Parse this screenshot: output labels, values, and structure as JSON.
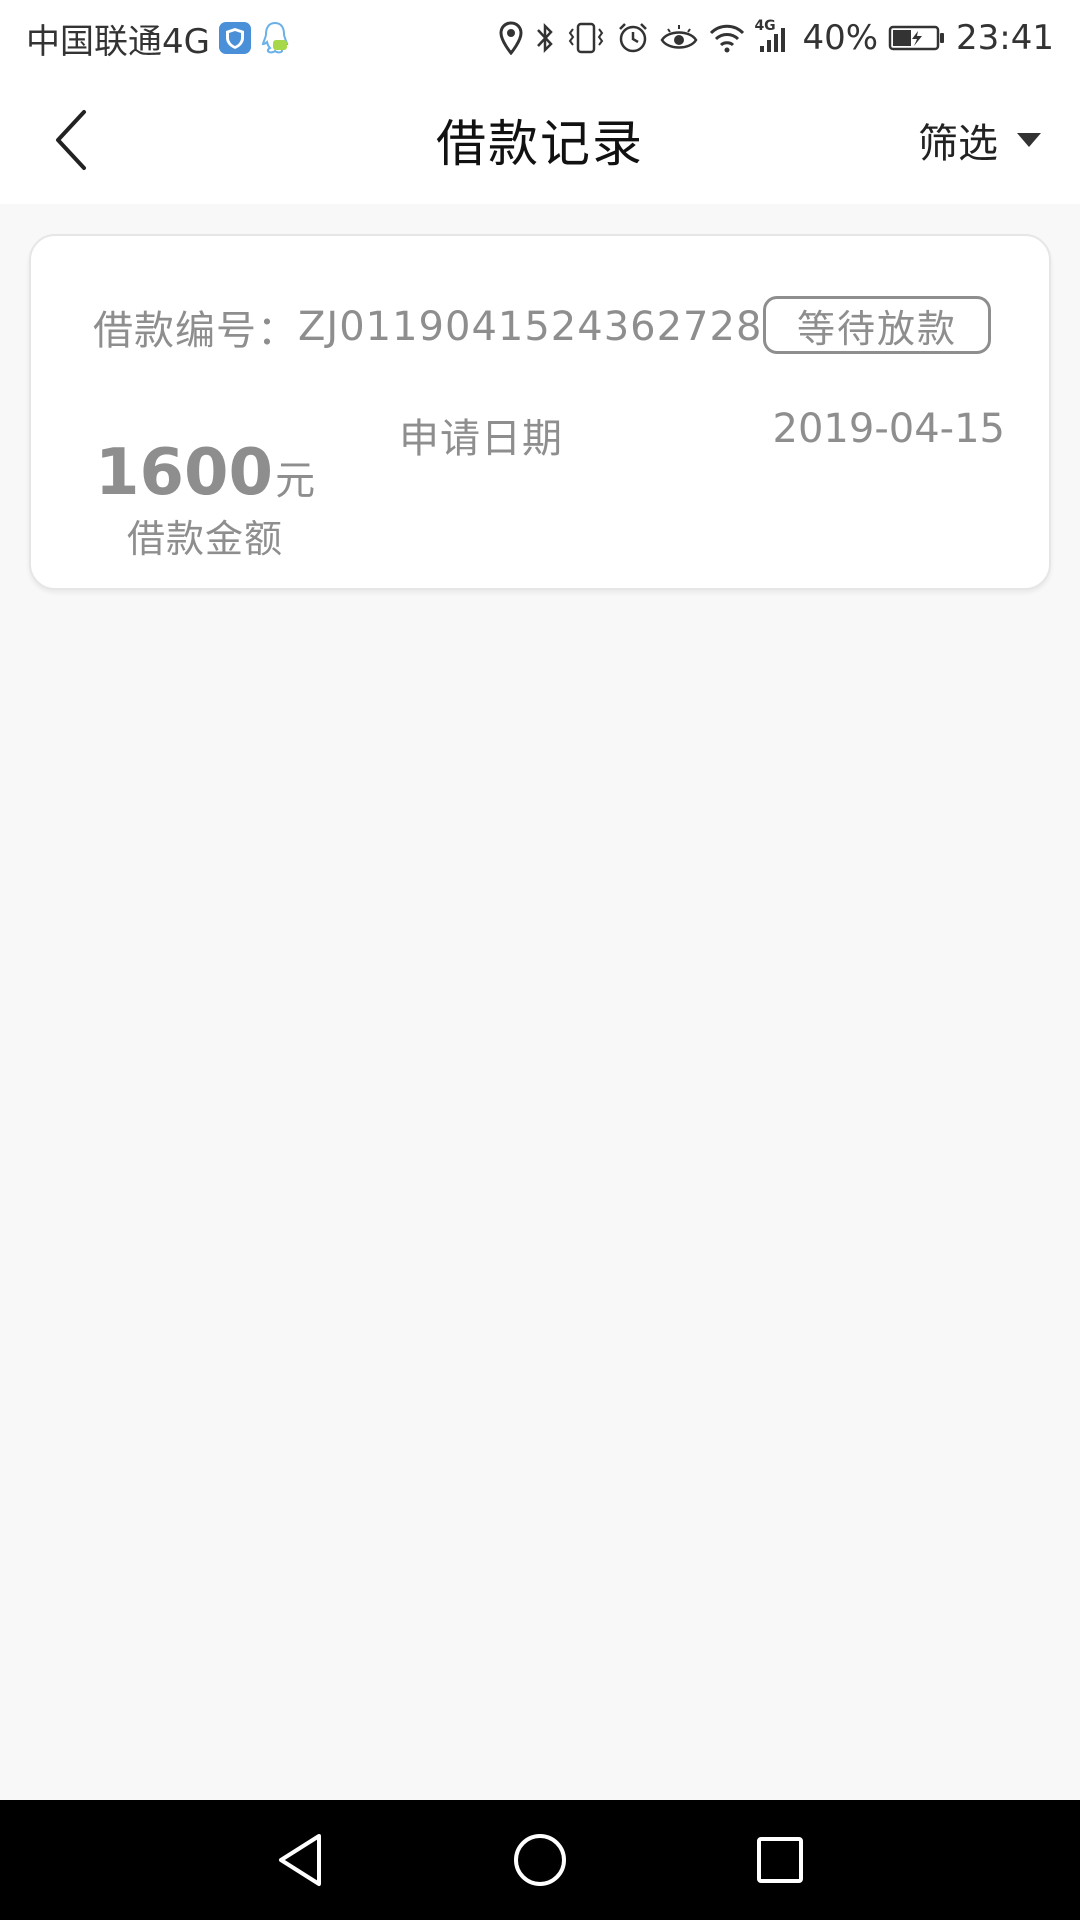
{
  "status_bar": {
    "carrier": "中国联通4G",
    "battery": "40%",
    "time": "23:41",
    "network_badge": "4G",
    "icons": [
      "shield-icon",
      "qq-icon",
      "location-icon",
      "bluetooth-icon",
      "vibrate-icon",
      "alarm-icon",
      "eye-icon",
      "wifi-icon",
      "signal-icon",
      "battery-icon"
    ]
  },
  "header": {
    "title": "借款记录",
    "filter_label": "筛选"
  },
  "loan_card": {
    "number_label": "借款编号：",
    "number_value": "ZJ0119041524362728",
    "status": "等待放款",
    "amount": "1600",
    "amount_unit": "元",
    "amount_label": "借款金额",
    "apply_date_label": "申请日期",
    "apply_date_value": "2019-04-15"
  },
  "colors": {
    "background": "#f8f8f8",
    "card": "#ffffff",
    "muted_text": "#8e8e8e",
    "title_text": "#111111",
    "nav_bar": "#000000"
  }
}
